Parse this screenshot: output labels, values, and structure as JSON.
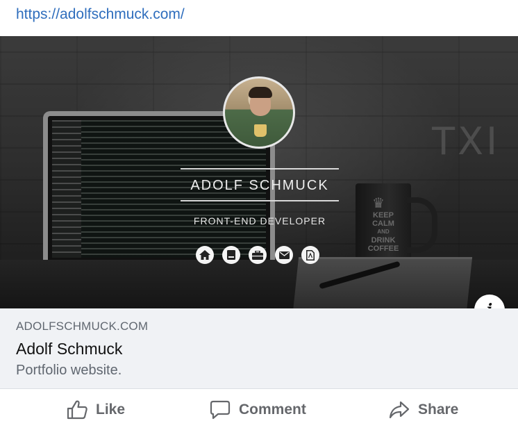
{
  "post": {
    "url_text": "https://adolfschmuck.com/"
  },
  "hero": {
    "name": "ADOLF SCHMUCK",
    "role": "FRONT-END DEVELOPER",
    "mug_text_line1": "KEEP",
    "mug_text_line2": "CALM",
    "mug_text_line3": "AND",
    "mug_text_line4": "DRINK",
    "mug_text_line5": "COFFEE",
    "wall_text": "TXI",
    "social_icons": [
      "home-icon",
      "book-icon",
      "briefcase-icon",
      "envelope-icon",
      "document-icon"
    ],
    "info_label": "i"
  },
  "link_card": {
    "domain": "ADOLFSCHMUCK.COM",
    "title": "Adolf Schmuck",
    "description": "Portfolio website."
  },
  "actions": {
    "like_label": "Like",
    "comment_label": "Comment",
    "share_label": "Share"
  },
  "colors": {
    "link": "#2f6ebd",
    "card_bg": "#f0f2f5",
    "muted_text": "#606770",
    "action_text": "#65676b"
  }
}
